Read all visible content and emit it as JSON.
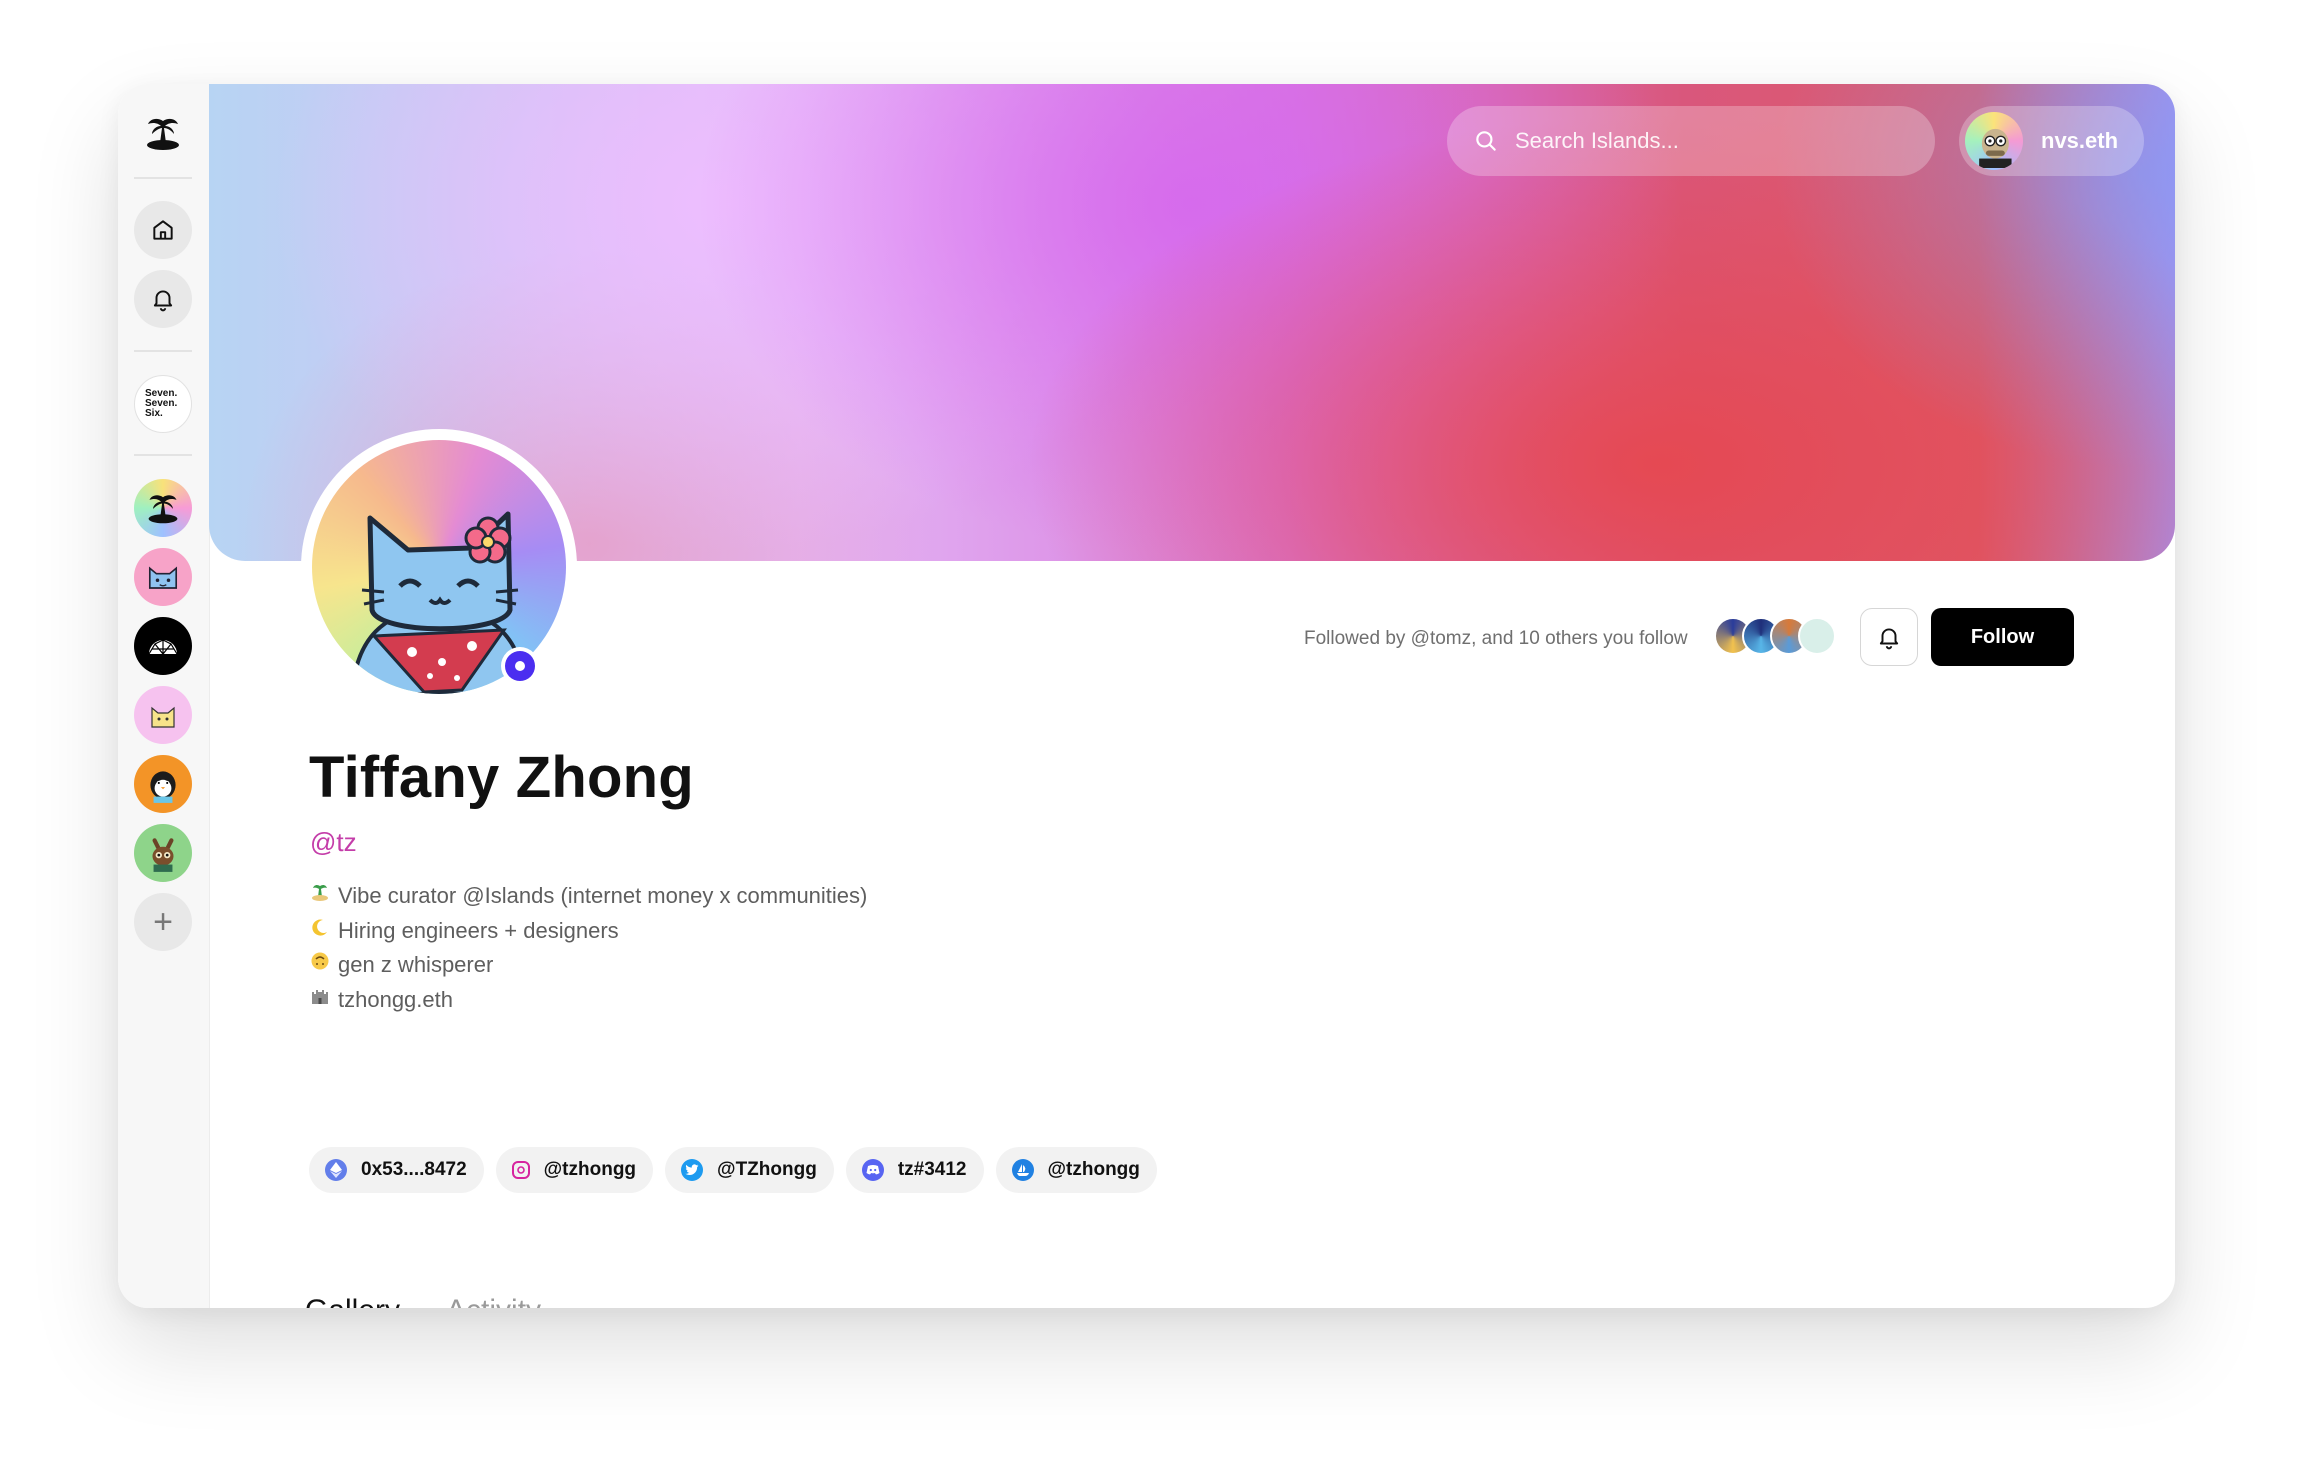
{
  "search": {
    "placeholder": "Search Islands..."
  },
  "user": {
    "name": "nvs.eth"
  },
  "sidebar": {
    "community_label": "Seven.\nSeven.\nSix.",
    "add_label": "+"
  },
  "profile": {
    "name": "Tiffany Zhong",
    "handle": "@tz",
    "bio": [
      {
        "emoji": "island-icon",
        "text": "Vibe curator @Islands (internet money x communities)"
      },
      {
        "emoji": "crescent-moon-icon",
        "text": "Hiring engineers + designers"
      },
      {
        "emoji": "upside-down-face-icon",
        "text": "gen z whisperer"
      },
      {
        "emoji": "castle-icon",
        "text": "tzhongg.eth"
      }
    ],
    "followed_by": "Followed by @tomz, and 10 others you follow",
    "follow_label": "Follow"
  },
  "links": [
    {
      "icon": "ethereum-icon",
      "label": "0x53....8472",
      "color": "#627eea"
    },
    {
      "icon": "instagram-icon",
      "label": "@tzhongg",
      "color": "#d6249f"
    },
    {
      "icon": "twitter-icon",
      "label": "@TZhongg",
      "color": "#1d9bf0"
    },
    {
      "icon": "discord-icon",
      "label": "tz#3412",
      "color": "#5865f2"
    },
    {
      "icon": "opensea-icon",
      "label": "@tzhongg",
      "color": "#2081e2"
    }
  ],
  "tabs": [
    {
      "label": "Gallery",
      "active": true
    },
    {
      "label": "Activity",
      "active": false
    }
  ],
  "colors": {
    "handle": "#c43da9",
    "online_dot": "#4b2ef0",
    "follow_button": "#000000"
  }
}
